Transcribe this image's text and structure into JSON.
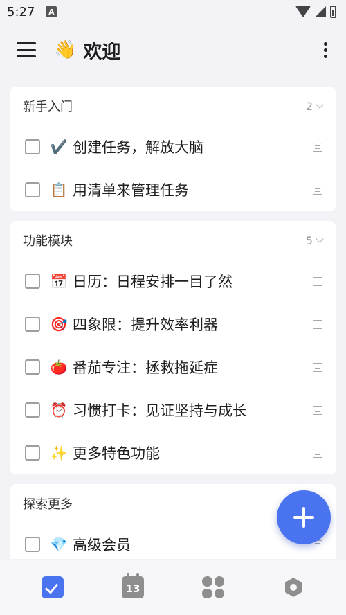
{
  "status_bar": {
    "time": "5:27",
    "notification_icon": "A"
  },
  "header": {
    "emoji": "👋",
    "title": "欢迎"
  },
  "sections": [
    {
      "title": "新手入门",
      "count": "2",
      "items": [
        {
          "emoji": "✔️",
          "text": "创建任务，解放大脑"
        },
        {
          "emoji": "📋",
          "text": "用清单来管理任务"
        }
      ]
    },
    {
      "title": "功能模块",
      "count": "5",
      "items": [
        {
          "emoji": "📅",
          "text": "日历：日程安排一目了然"
        },
        {
          "emoji": "🎯",
          "text": "四象限：提升效率利器"
        },
        {
          "emoji": "🍅",
          "text": "番茄专注：拯救拖延症"
        },
        {
          "emoji": "⏰",
          "text": "习惯打卡：见证坚持与成长"
        },
        {
          "emoji": "✨",
          "text": "更多特色功能"
        }
      ]
    },
    {
      "title": "探索更多",
      "count": "",
      "items": [
        {
          "emoji": "💎",
          "text": "高级会员"
        }
      ]
    }
  ],
  "bottom_nav": {
    "calendar_day": "13",
    "items": [
      "tasks-icon",
      "calendar-icon",
      "quadrant-icon",
      "hexagon-icon"
    ]
  },
  "colors": {
    "accent": "#4a73f0",
    "background": "#f3f3f7"
  }
}
